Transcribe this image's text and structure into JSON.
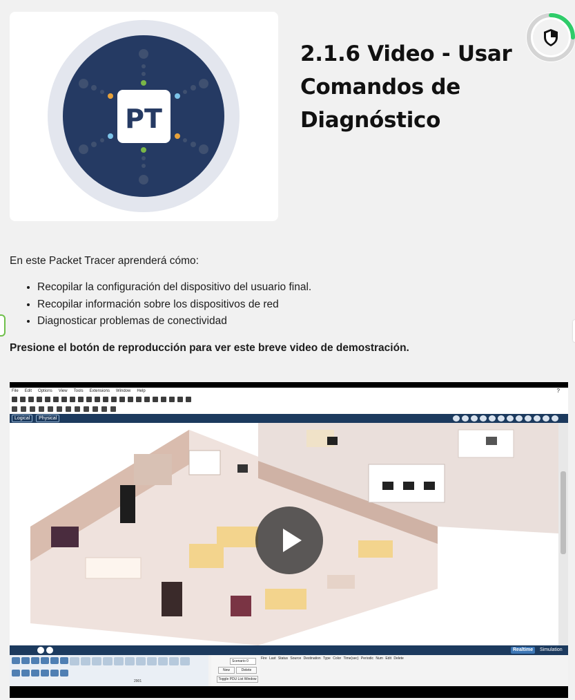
{
  "header": {
    "logo_text": "PT",
    "title_lines": [
      "2.1.6 Video - Usar",
      "Comandos de",
      "Diagnóstico"
    ],
    "progress_fraction": 0.25,
    "badge_icon": "shield-icon"
  },
  "content": {
    "intro": "En este Packet Tracer aprenderá cómo:",
    "bullets": [
      "Recopilar la configuración del dispositivo del usuario final.",
      "Recopilar información sobre los dispositivos de red",
      "Diagnosticar problemas de conectividad"
    ],
    "instruction": "Presione el botón de reproducción para ver este breve video de demostración."
  },
  "video": {
    "play_icon": "play-icon",
    "menu": [
      "File",
      "Edit",
      "Options",
      "View",
      "Tools",
      "Extensions",
      "Window",
      "Help"
    ],
    "help_mark": "?",
    "view_tabs": [
      "Logical",
      "Physical"
    ],
    "realtime_label": "Realtime",
    "simulation_label": "Simulation",
    "scenario_value": "Scenario 0",
    "new_label": "New",
    "delete_label": "Delete",
    "toggle_label": "Toggle PDU List Window",
    "device_id": "2901",
    "pdu_columns": [
      "Fire",
      "Last Status",
      "Source",
      "Destination",
      "Type",
      "Color",
      "Time(sec)",
      "Periodic",
      "Num",
      "Edit",
      "Delete"
    ]
  },
  "colors": {
    "logo_navy": "#253a63",
    "logo_ring": "#e3e6ee",
    "progress_green": "#2fcc6a",
    "pt_bar_blue": "#1c3a5e"
  }
}
